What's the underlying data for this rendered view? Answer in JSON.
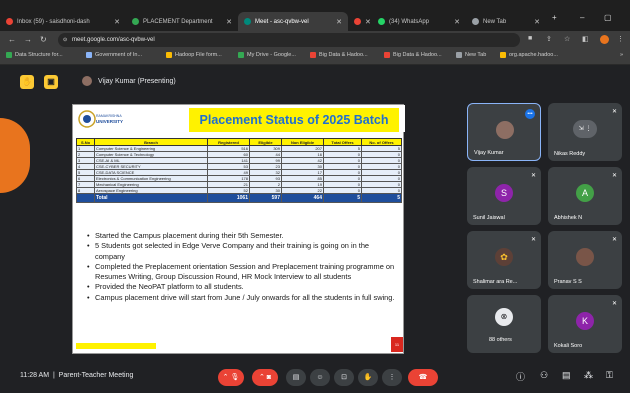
{
  "browser": {
    "tabs": [
      {
        "label": "Inbox (59) - saisdhoni-dash",
        "color": "#ea4335"
      },
      {
        "label": "PLACEMENT Department",
        "color": "#34a853"
      },
      {
        "label": "Meet - asc-qvbw-vel",
        "color": "#00897b"
      },
      {
        "label": "",
        "color": "#ea4335"
      },
      {
        "label": "(34) WhatsApp",
        "color": "#25d366"
      },
      {
        "label": "New Tab",
        "color": "#9aa0a6"
      }
    ],
    "url": "meet.google.com/asc-qvbw-vel",
    "bookmarks": [
      {
        "label": "Data Structure for...",
        "color": "#34a853"
      },
      {
        "label": "Government of In...",
        "color": "#8ab4f8"
      },
      {
        "label": "Hadoop File form...",
        "color": "#fbbc04"
      },
      {
        "label": "My Drive - Google...",
        "color": "#34a853"
      },
      {
        "label": "Big Data & Hadoo...",
        "color": "#ea4335"
      },
      {
        "label": "Big Data & Hadoo...",
        "color": "#ea4335"
      },
      {
        "label": "New Tab",
        "color": "#9aa0a6"
      },
      {
        "label": "org.apache.hadoo...",
        "color": "#fbbc04"
      }
    ]
  },
  "presenter": "Vijay Kumar (Presenting)",
  "slide": {
    "logo_text": "RAMAKRISHNA UNIVERSITY",
    "title": "Placement Status of 2025 Batch",
    "headers": [
      "S.No",
      "Branch",
      "Registered",
      "Eligible",
      "Non Eligible",
      "Total Offers",
      "No. of Offers"
    ],
    "rows": [
      [
        "1",
        "Computer Science & Engineering",
        "516",
        "309",
        "207",
        "5",
        "5"
      ],
      [
        "2",
        "Computer Science & Technology",
        "60",
        "44",
        "16",
        "0",
        "0"
      ],
      [
        "3",
        "CSE-AI & ML",
        "141",
        "99",
        "42",
        "0",
        "0"
      ],
      [
        "4",
        "CSE-CYBER SECURITY",
        "53",
        "23",
        "30",
        "0",
        "0"
      ],
      [
        "5",
        "CSE-DATA SCIENCE",
        "49",
        "32",
        "17",
        "0",
        "0"
      ],
      [
        "6",
        "Electronics & Communication Engineering",
        "178",
        "93",
        "85",
        "0",
        "0"
      ],
      [
        "7",
        "Mechanical Engineering",
        "21",
        "2",
        "19",
        "0",
        "0"
      ],
      [
        "8",
        "Aerospace Engineering",
        "52",
        "30",
        "22",
        "0",
        "0"
      ]
    ],
    "total": [
      "",
      "Total",
      "1061",
      "597",
      "464",
      "5",
      "5"
    ],
    "bullets": [
      "Started the Campus placement during their 5th Semester.",
      "5 Students got selected in Edge Verve Company and their training is going on in the company",
      "Completed the Preplacement orientation Session and Preplacement training programme on Resumes Writing, Group Discussion Round, HR Mock Interview to all students",
      "Provided the NeoPAT platform to all students.",
      "Campus placement drive will start from June / July onwards for all the students in full swing."
    ],
    "page_number": "11"
  },
  "participants": [
    {
      "name": "Vijay Kumar",
      "initial": "",
      "color": "#5f6368"
    },
    {
      "name": "Nikas Reddy",
      "initial": "",
      "color": "#5f6368"
    },
    {
      "name": "Sunil Jaiswal",
      "initial": "S",
      "color": "#8e24aa"
    },
    {
      "name": "Abhishek N",
      "initial": "A",
      "color": "#43a047"
    },
    {
      "name": "Shalimar ara Re...",
      "initial": "",
      "color": "#5f6368"
    },
    {
      "name": "Pranav S S",
      "initial": "",
      "color": "#5f6368"
    },
    {
      "name": "88 others",
      "initial": "",
      "color": "#5f6368"
    },
    {
      "name": "Kokali Soro",
      "initial": "K",
      "color": "#8e24aa"
    }
  ],
  "meeting": {
    "time": "11:28 AM",
    "title": "Parent-Teacher Meeting"
  }
}
